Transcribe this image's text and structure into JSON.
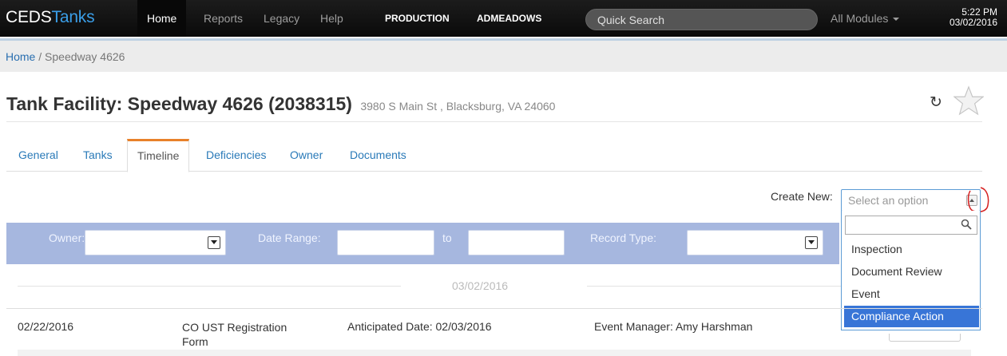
{
  "navbar": {
    "brand_part1": "CEDS",
    "brand_part2": "Tanks",
    "items": [
      {
        "label": "Home"
      },
      {
        "label": "Reports"
      },
      {
        "label": "Legacy"
      },
      {
        "label": "Help"
      },
      {
        "label": "PRODUCTION"
      },
      {
        "label": "ADMEADOWS"
      }
    ],
    "search_placeholder": "Quick Search",
    "modules_label": "All Modules",
    "time": "5:22 PM",
    "date": "03/02/2016",
    "brand_accent_color": "#3a9ee8"
  },
  "breadcrumb": {
    "home": "Home",
    "separator": " / ",
    "current": "Speedway 4626"
  },
  "page": {
    "title": "Tank Facility: Speedway 4626 (2038315)",
    "address": "3980 S Main St , Blacksburg, VA 24060"
  },
  "tabs": [
    {
      "label": "General"
    },
    {
      "label": "Tanks"
    },
    {
      "label": "Timeline",
      "active": true
    },
    {
      "label": "Deficiencies"
    },
    {
      "label": "Owner"
    },
    {
      "label": "Documents"
    }
  ],
  "create_new": {
    "label": "Create New:",
    "placeholder": "Select an option",
    "options": [
      {
        "label": "Inspection"
      },
      {
        "label": "Document Review"
      },
      {
        "label": "Event"
      },
      {
        "label": "Compliance Action",
        "highlighted": true
      }
    ],
    "highlight_color": "#3875d7"
  },
  "filters": {
    "owner_label": "Owner:",
    "date_range_label": "Date Range:",
    "to_label": "to",
    "record_type_label": "Record Type:",
    "bar_color": "#a6b7df"
  },
  "timeline": {
    "separator_date": "03/02/2016",
    "rows": [
      {
        "date": "02/22/2016",
        "title_line1": "CO UST Registration",
        "title_line2": "Form",
        "anticipated": "Anticipated Date: 02/03/2016",
        "manager": "Event Manager: Amy Harshman"
      }
    ]
  }
}
